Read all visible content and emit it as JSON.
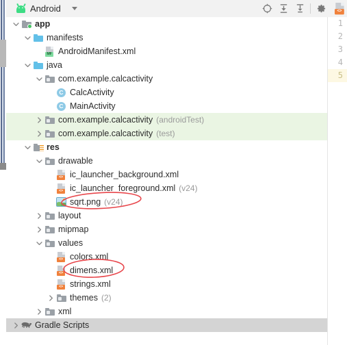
{
  "window": {
    "title": "Android",
    "icon": "android-robot-icon"
  },
  "toolbar": {
    "buttons": [
      {
        "name": "select-opened-file-icon",
        "tooltip": "Select Opened File"
      },
      {
        "name": "expand-all-icon",
        "tooltip": "Expand All"
      },
      {
        "name": "collapse-all-icon",
        "tooltip": "Collapse All"
      },
      {
        "name": "settings-gear-icon",
        "tooltip": "Settings"
      },
      {
        "name": "minimize-icon",
        "tooltip": "Hide"
      }
    ],
    "dropdown_label": "Android",
    "chevron": "chevron-down-icon"
  },
  "editor_gutter": {
    "line_numbers": [
      "1",
      "2",
      "3",
      "4",
      "5"
    ],
    "active_line": "5",
    "active_line_color": "#fdf8e3",
    "corner_icon": "xml-file-icon"
  },
  "tree": {
    "rows": [
      {
        "indent": 0,
        "twisty": "expanded",
        "icon": "module-folder-icon",
        "label": "app",
        "bold": true,
        "suffix": "",
        "state": ""
      },
      {
        "indent": 1,
        "twisty": "expanded",
        "icon": "folder-blue-icon",
        "label": "manifests",
        "bold": false,
        "suffix": "",
        "state": ""
      },
      {
        "indent": 2,
        "twisty": "none",
        "icon": "manifest-file-icon",
        "label": "AndroidManifest.xml",
        "bold": false,
        "suffix": "",
        "state": ""
      },
      {
        "indent": 1,
        "twisty": "expanded",
        "icon": "folder-blue-icon",
        "label": "java",
        "bold": false,
        "suffix": "",
        "state": ""
      },
      {
        "indent": 2,
        "twisty": "expanded",
        "icon": "package-folder-icon",
        "label": "com.example.calcactivity",
        "bold": false,
        "suffix": "",
        "state": ""
      },
      {
        "indent": 3,
        "twisty": "none",
        "icon": "java-class-icon",
        "label": "CalcActivity",
        "bold": false,
        "suffix": "",
        "state": ""
      },
      {
        "indent": 3,
        "twisty": "none",
        "icon": "java-class-icon",
        "label": "MainActivity",
        "bold": false,
        "suffix": "",
        "state": ""
      },
      {
        "indent": 2,
        "twisty": "collapsed",
        "icon": "package-folder-icon",
        "label": "com.example.calcactivity",
        "bold": false,
        "suffix": "(androidTest)",
        "state": "highlighted"
      },
      {
        "indent": 2,
        "twisty": "collapsed",
        "icon": "package-folder-icon",
        "label": "com.example.calcactivity",
        "bold": false,
        "suffix": "(test)",
        "state": "highlighted"
      },
      {
        "indent": 1,
        "twisty": "expanded",
        "icon": "res-folder-icon",
        "label": "res",
        "bold": true,
        "suffix": "",
        "state": ""
      },
      {
        "indent": 2,
        "twisty": "expanded",
        "icon": "package-folder-icon",
        "label": "drawable",
        "bold": false,
        "suffix": "",
        "state": ""
      },
      {
        "indent": 3,
        "twisty": "none",
        "icon": "xml-file-icon",
        "label": "ic_launcher_background.xml",
        "bold": false,
        "suffix": "",
        "state": ""
      },
      {
        "indent": 3,
        "twisty": "none",
        "icon": "xml-file-icon",
        "label": "ic_launcher_foreground.xml",
        "bold": false,
        "suffix": "(v24)",
        "state": ""
      },
      {
        "indent": 3,
        "twisty": "none",
        "icon": "png-image-icon",
        "label": "sqrt.png",
        "bold": false,
        "suffix": "(v24)",
        "state": ""
      },
      {
        "indent": 2,
        "twisty": "collapsed",
        "icon": "package-folder-icon",
        "label": "layout",
        "bold": false,
        "suffix": "",
        "state": ""
      },
      {
        "indent": 2,
        "twisty": "collapsed",
        "icon": "package-folder-icon",
        "label": "mipmap",
        "bold": false,
        "suffix": "",
        "state": ""
      },
      {
        "indent": 2,
        "twisty": "expanded",
        "icon": "package-folder-icon",
        "label": "values",
        "bold": false,
        "suffix": "",
        "state": ""
      },
      {
        "indent": 3,
        "twisty": "none",
        "icon": "xml-file-icon",
        "label": "colors.xml",
        "bold": false,
        "suffix": "",
        "state": ""
      },
      {
        "indent": 3,
        "twisty": "none",
        "icon": "xml-file-icon",
        "label": "dimens.xml",
        "bold": false,
        "suffix": "",
        "state": ""
      },
      {
        "indent": 3,
        "twisty": "none",
        "icon": "xml-file-icon",
        "label": "strings.xml",
        "bold": false,
        "suffix": "",
        "state": ""
      },
      {
        "indent": 3,
        "twisty": "collapsed",
        "icon": "package-folder-icon",
        "label": "themes",
        "bold": false,
        "suffix": "(2)",
        "state": ""
      },
      {
        "indent": 2,
        "twisty": "collapsed",
        "icon": "package-folder-icon",
        "label": "xml",
        "bold": false,
        "suffix": "",
        "state": ""
      },
      {
        "indent": 0,
        "twisty": "collapsed",
        "icon": "gradle-elephant-icon",
        "label": "Gradle Scripts",
        "bold": false,
        "suffix": "",
        "state": "selected"
      }
    ]
  },
  "annotations": {
    "ink_color": "#e8464b",
    "marks": [
      {
        "name": "ellipse-around-sqrt-png",
        "target": "sqrt.png"
      },
      {
        "name": "ellipse-around-dimens-xml",
        "target": "dimens.xml"
      }
    ]
  },
  "colors": {
    "highlight_row": "#eaf5e3",
    "selected_row": "#d4d4d4",
    "toolbar_bg": "#f2f2f2",
    "android_green": "#3ddc84",
    "folder_blue": "#62c0e8",
    "xml_badge": "#f0813c",
    "manifest_badge": "#7fdca0"
  }
}
